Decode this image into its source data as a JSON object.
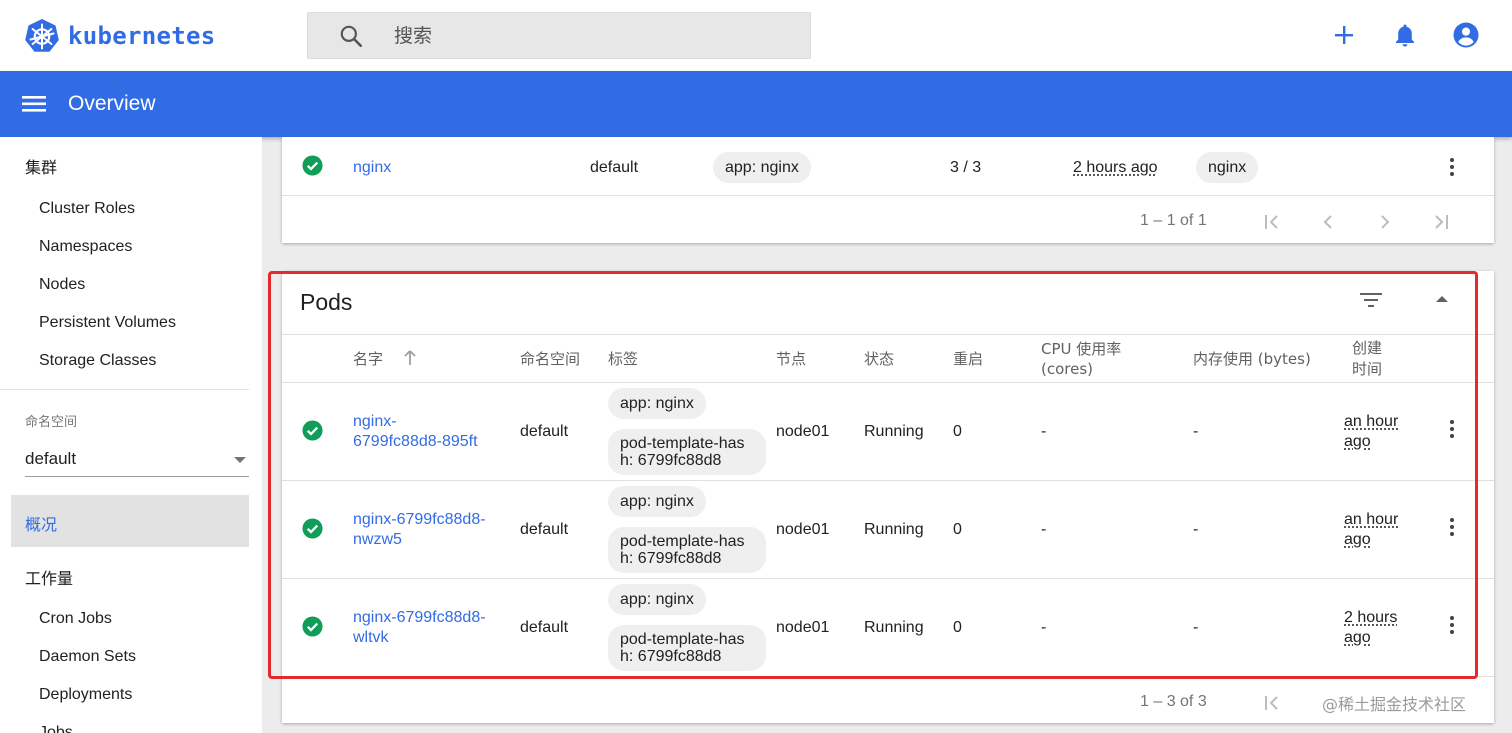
{
  "app": {
    "name": "kubernetes"
  },
  "search": {
    "placeholder": "搜索"
  },
  "header": {
    "title": "Overview"
  },
  "sidebar": {
    "section_cluster": "集群",
    "cluster_items": [
      "Cluster Roles",
      "Namespaces",
      "Nodes",
      "Persistent Volumes",
      "Storage Classes"
    ],
    "namespace_label": "命名空间",
    "namespace_value": "default",
    "overview": "概况",
    "section_workloads": "工作量",
    "workload_items": [
      "Cron Jobs",
      "Daemon Sets",
      "Deployments",
      "Jobs"
    ]
  },
  "deployment_row": {
    "name": "nginx",
    "namespace": "default",
    "label": "app: nginx",
    "pods": "3 / 3",
    "age": "2 hours ago",
    "image": "nginx"
  },
  "deployments_pager": {
    "range": "1 – 1 of 1"
  },
  "pods": {
    "title": "Pods",
    "columns": {
      "name": "名字",
      "namespace": "命名空间",
      "labels": "标签",
      "node": "节点",
      "status": "状态",
      "restarts": "重启",
      "cpu_1": "CPU 使用率",
      "cpu_2": "(cores)",
      "memory": "内存使用 (bytes)",
      "created_1": "创建",
      "created_2": "时间"
    },
    "rows": [
      {
        "name_1": "nginx-",
        "name_2": "6799fc88d8-895ft",
        "namespace": "default",
        "label_1": "app: nginx",
        "label_2a": "pod-template-has",
        "label_2b": "h: 6799fc88d8",
        "node": "node01",
        "status": "Running",
        "restarts": "0",
        "cpu": "-",
        "memory": "-",
        "created_1": "an hour",
        "created_2": "ago"
      },
      {
        "name_1": "nginx-6799fc88d8-",
        "name_2": "nwzw5",
        "namespace": "default",
        "label_1": "app: nginx",
        "label_2a": "pod-template-has",
        "label_2b": "h: 6799fc88d8",
        "node": "node01",
        "status": "Running",
        "restarts": "0",
        "cpu": "-",
        "memory": "-",
        "created_1": "an hour",
        "created_2": "ago"
      },
      {
        "name_1": "nginx-6799fc88d8-",
        "name_2": "wltvk",
        "namespace": "default",
        "label_1": "app: nginx",
        "label_2a": "pod-template-has",
        "label_2b": "h: 6799fc88d8",
        "node": "node01",
        "status": "Running",
        "restarts": "0",
        "cpu": "-",
        "memory": "-",
        "created_1": "2 hours",
        "created_2": "ago"
      }
    ],
    "pager": {
      "range": "1 – 3 of 3"
    }
  },
  "watermark": "@稀土掘金技术社区",
  "colors": {
    "primary": "#326ce5",
    "success": "#0f9d58",
    "highlight": "#e42a2a"
  }
}
